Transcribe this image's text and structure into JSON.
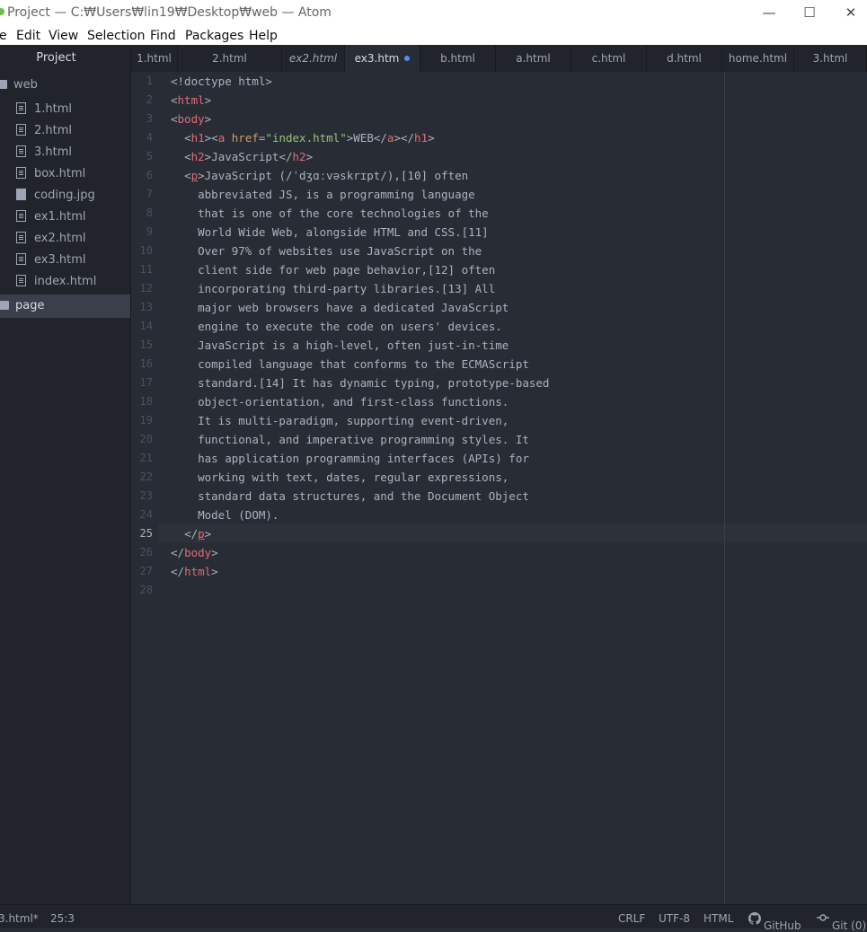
{
  "window": {
    "title": "Project — C:₩Users₩lin19₩Desktop₩web — Atom",
    "minimize_glyph": "—",
    "maximize_glyph": "☐",
    "close_glyph": "✕"
  },
  "menu": [
    "e",
    "Edit",
    "View",
    "Selection",
    "Find",
    "Packages",
    "Help"
  ],
  "sidebar": {
    "header": "Project",
    "root_folder": "web",
    "files": [
      "1.html",
      "2.html",
      "3.html",
      "box.html",
      "coding.jpg",
      "ex1.html",
      "ex2.html",
      "ex3.html",
      "index.html"
    ],
    "sub_folder": "page"
  },
  "tabs": [
    {
      "label": "1.html"
    },
    {
      "label": "2.html"
    },
    {
      "label": "ex2.html"
    },
    {
      "label": "ex3.htm"
    },
    {
      "label": "b.html"
    },
    {
      "label": "a.html"
    },
    {
      "label": "c.html"
    },
    {
      "label": "d.html"
    },
    {
      "label": "home.html"
    },
    {
      "label": "3.html"
    }
  ],
  "editor": {
    "line_numbers": [
      "1",
      "2",
      "3",
      "4",
      "5",
      "6",
      "7",
      "8",
      "9",
      "10",
      "11",
      "12",
      "13",
      "14",
      "15",
      "16",
      "17",
      "18",
      "19",
      "20",
      "21",
      "22",
      "23",
      "24",
      "25",
      "26",
      "27",
      "28"
    ],
    "cursor_line": "25",
    "lines": {
      "l1": "<!doctype html>",
      "l2_tag": "html",
      "l3_tag": "body",
      "l4_tag": "h1",
      "l4_a": "a",
      "l4_attr": "href",
      "l4_str": "\"index.html\"",
      "l4_text": "WEB",
      "l5_tag": "h2",
      "l5_text": "JavaScript",
      "l6_tag": "p",
      "l6_text": "JavaScript (/ˈdʒɑːvəskrɪpt/),[10] often",
      "l7": "abbreviated JS, is a programming language",
      "l8": "that is one of the core technologies of the",
      "l9": "World Wide Web, alongside HTML and CSS.[11]",
      "l10": "Over 97% of websites use JavaScript on the",
      "l11": "client side for web page behavior,[12] often",
      "l12": "incorporating third-party libraries.[13] All",
      "l13": "major web browsers have a dedicated JavaScript",
      "l14": "engine to execute the code on users' devices.",
      "l15": "JavaScript is a high-level, often just-in-time",
      "l16": "compiled language that conforms to the ECMAScript",
      "l17": "standard.[14] It has dynamic typing, prototype-based",
      "l18": "object-orientation, and first-class functions.",
      "l19": "It is multi-paradigm, supporting event-driven,",
      "l20": "functional, and imperative programming styles. It",
      "l21": "has application programming interfaces (APIs) for",
      "l22": "working with text, dates, regular expressions,",
      "l23": "standard data structures, and the Document Object",
      "l24": "Model (DOM).",
      "l25_tag": "p",
      "l26_tag": "body",
      "l27_tag": "html"
    }
  },
  "status": {
    "file": "3.html*",
    "position": "25:3",
    "line_ending": "CRLF",
    "encoding": "UTF-8",
    "grammar": "HTML",
    "github": "GitHub",
    "git": "Git (0)"
  }
}
